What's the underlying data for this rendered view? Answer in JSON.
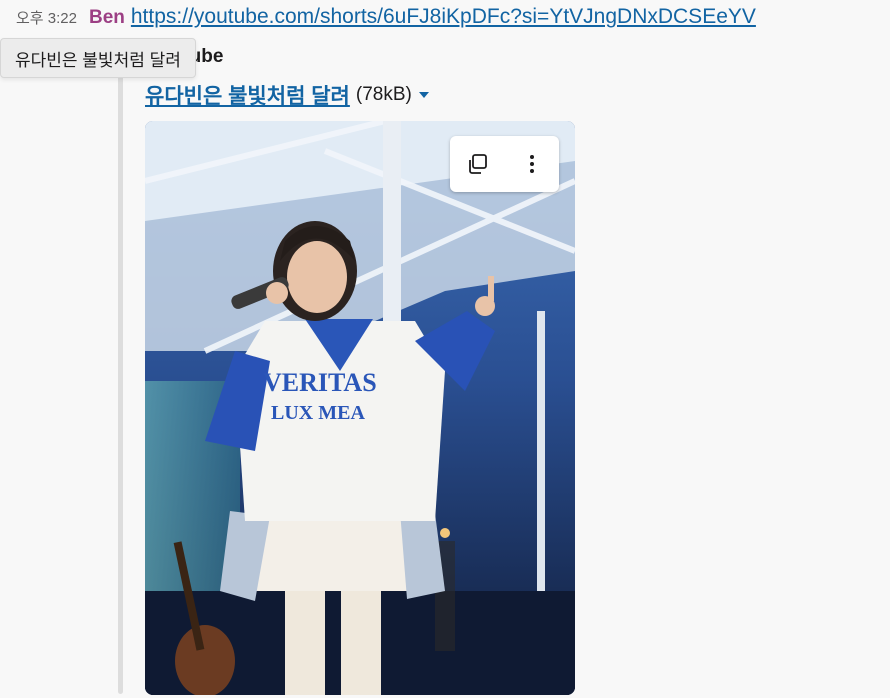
{
  "message": {
    "timestamp": "오후 3:22",
    "sender": "Ben",
    "link_text": "https://youtube.com/shorts/6uFJ8iKpDFc?si=YtVJngDNxDCSEeYV"
  },
  "tooltip": {
    "text": "유다빈은 불빛처럼 달려"
  },
  "attachment": {
    "provider": "YouTube",
    "title": "유다빈은 불빛처럼 달려",
    "size": "(78kB)",
    "thumbnail": {
      "shirt_text_line1": "VERITAS",
      "shirt_text_line2": "LUX MEA"
    },
    "actions": [
      {
        "icon": "copy-icon"
      },
      {
        "icon": "more-vertical-icon"
      }
    ]
  },
  "colors": {
    "sender": "#9c3f84",
    "link": "#1264a3",
    "background": "#f8f8f8"
  }
}
